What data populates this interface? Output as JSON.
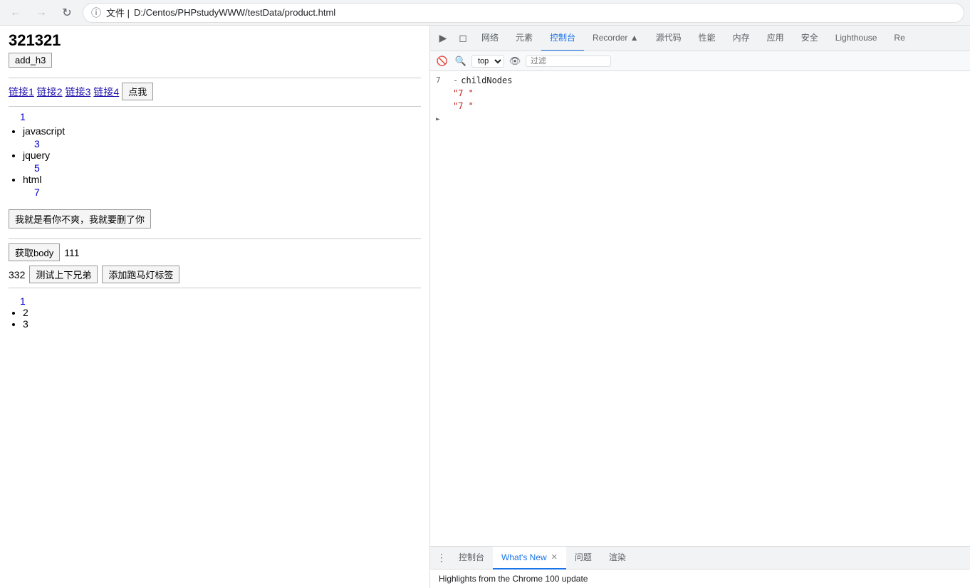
{
  "browser": {
    "url": "D:/Centos/PHPstudyWWW/testData/product.html",
    "url_prefix": "文件 |",
    "back_disabled": true,
    "forward_disabled": true
  },
  "webpage": {
    "title": "321321",
    "btn_add_h3": "add_h3",
    "links": [
      "链接1",
      "链接2",
      "链接3",
      "链接4"
    ],
    "btn_click": "点我",
    "num1": "1",
    "list_items": [
      "javascript",
      "jquery",
      "html"
    ],
    "num3": "3",
    "num5": "5",
    "num7": "7",
    "btn_delete": "我就是看你不爽，我就要删了你",
    "btn_get_body": "获取body",
    "num_111": "111",
    "num_332": "332",
    "btn_sibling": "测试上下兄弟",
    "btn_marquee": "添加跑马灯标签",
    "list2_num1": "1",
    "list2_item1": "2",
    "list2_item2": "3"
  },
  "devtools": {
    "tabs": [
      {
        "label": "网络",
        "active": false
      },
      {
        "label": "元素",
        "active": false
      },
      {
        "label": "控制台",
        "active": true
      },
      {
        "label": "Recorder ▲",
        "active": false
      },
      {
        "label": "源代码",
        "active": false
      },
      {
        "label": "性能",
        "active": false
      },
      {
        "label": "内存",
        "active": false
      },
      {
        "label": "应用",
        "active": false
      },
      {
        "label": "安全",
        "active": false
      },
      {
        "label": "Lighthouse",
        "active": false
      },
      {
        "label": "Re",
        "active": false
      }
    ],
    "context_select": "top",
    "filter_placeholder": "过滤",
    "console_lines": [
      {
        "num": "7",
        "dash": "-",
        "text": "childNodes",
        "indent": 0,
        "expand": false
      },
      {
        "num": "",
        "dash": "",
        "text": "\"7 \"",
        "indent": 1,
        "is_string": true
      },
      {
        "num": "",
        "dash": "",
        "text": "\"7 \"",
        "indent": 1,
        "is_string": true
      }
    ],
    "bottom_tabs": [
      {
        "label": "控制台",
        "active": false,
        "closeable": false
      },
      {
        "label": "What's New",
        "active": true,
        "closeable": true
      },
      {
        "label": "问题",
        "active": false,
        "closeable": false
      },
      {
        "label": "渲染",
        "active": false,
        "closeable": false
      }
    ],
    "bottom_content": "Highlights from the Chrome 100 update"
  }
}
